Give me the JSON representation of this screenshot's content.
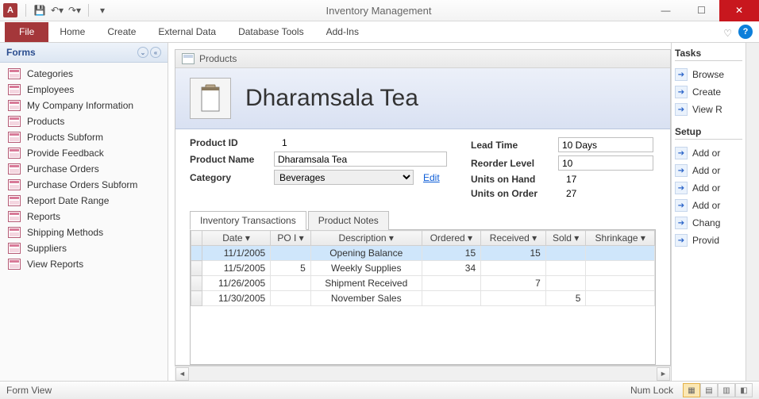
{
  "app_title": "Inventory Management",
  "qat": {
    "save": "save-icon",
    "undo": "undo-icon",
    "redo": "redo-icon"
  },
  "ribbon_tabs": {
    "file": "File",
    "home": "Home",
    "create": "Create",
    "external": "External Data",
    "dbtools": "Database Tools",
    "addins": "Add-Ins"
  },
  "nav": {
    "header": "Forms",
    "items": [
      "Categories",
      "Employees",
      "My Company Information",
      "Products",
      "Products Subform",
      "Provide Feedback",
      "Purchase Orders",
      "Purchase Orders Subform",
      "Report Date Range",
      "Reports",
      "Shipping Methods",
      "Suppliers",
      "View Reports"
    ]
  },
  "doc": {
    "tab_title": "Products",
    "heading": "Dharamsala Tea",
    "fields": {
      "product_id_label": "Product ID",
      "product_id": "1",
      "product_name_label": "Product Name",
      "product_name": "Dharamsala Tea",
      "category_label": "Category",
      "category": "Beverages",
      "edit": "Edit",
      "lead_time_label": "Lead Time",
      "lead_time": "10 Days",
      "reorder_label": "Reorder Level",
      "reorder": "10",
      "on_hand_label": "Units on Hand",
      "on_hand": "17",
      "on_order_label": "Units on Order",
      "on_order": "27"
    },
    "subtabs": {
      "transactions": "Inventory Transactions",
      "notes": "Product Notes"
    },
    "grid": {
      "cols": [
        "Date",
        "PO I",
        "Description",
        "Ordered",
        "Received",
        "Sold",
        "Shrinkage"
      ],
      "rows": [
        {
          "date": "11/1/2005",
          "po": "",
          "desc": "Opening Balance",
          "ordered": "15",
          "received": "15",
          "sold": "",
          "shrink": ""
        },
        {
          "date": "11/5/2005",
          "po": "5",
          "desc": "Weekly Supplies",
          "ordered": "34",
          "received": "",
          "sold": "",
          "shrink": ""
        },
        {
          "date": "11/26/2005",
          "po": "",
          "desc": "Shipment Received",
          "ordered": "",
          "received": "7",
          "sold": "",
          "shrink": ""
        },
        {
          "date": "11/30/2005",
          "po": "",
          "desc": "November Sales",
          "ordered": "",
          "received": "",
          "sold": "5",
          "shrink": ""
        }
      ]
    }
  },
  "tasks": {
    "h1": "Tasks",
    "links1": [
      "Browse",
      "Create",
      "View R"
    ],
    "h2": "Setup",
    "links2": [
      "Add or",
      "Add or",
      "Add or",
      "Add or",
      "Chang",
      "Provid"
    ]
  },
  "status": {
    "left": "Form View",
    "numlock": "Num Lock"
  }
}
